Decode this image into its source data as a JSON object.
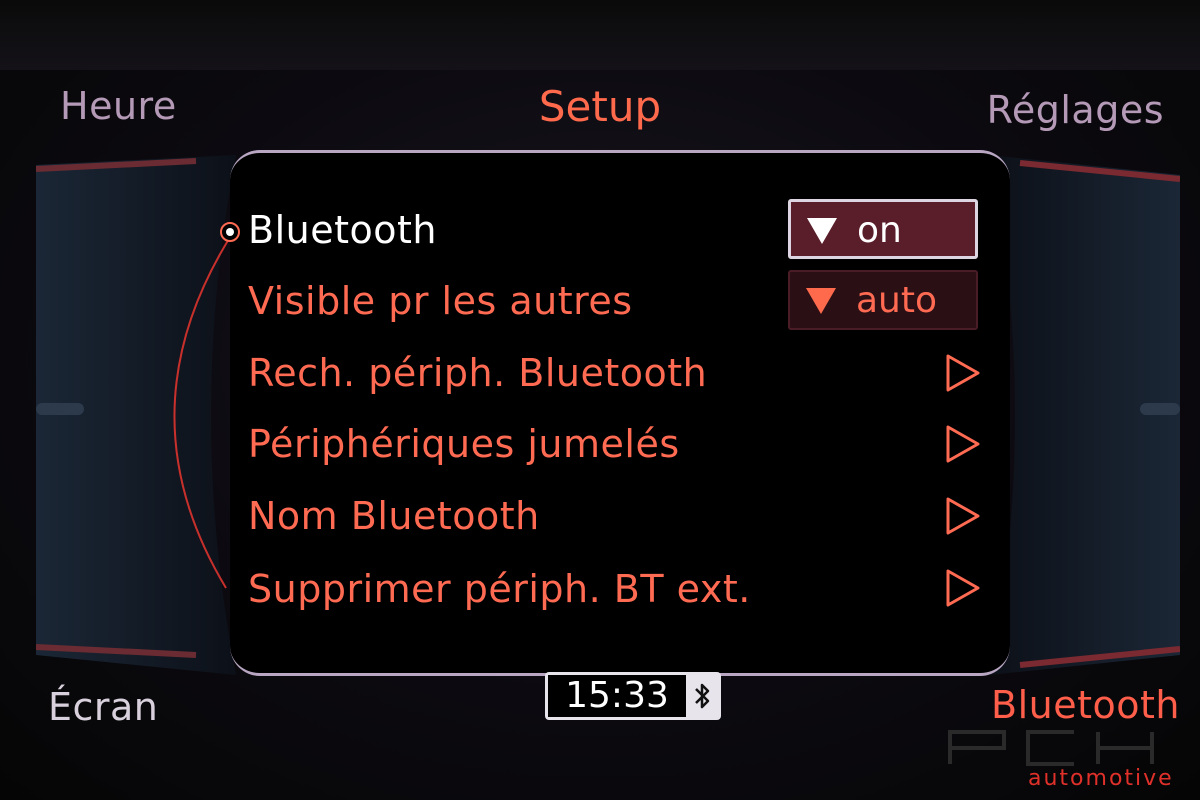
{
  "header": {
    "title": "Setup",
    "softkey_top_left": "Heure",
    "softkey_top_right": "Réglages"
  },
  "footer": {
    "softkey_bottom_left": "Écran",
    "softkey_bottom_right": "Bluetooth",
    "clock": "15:33"
  },
  "menu": {
    "items": [
      {
        "label": "Bluetooth",
        "control": "dropdown",
        "value": "on",
        "selected": true
      },
      {
        "label": "Visible pr les autres",
        "control": "dropdown",
        "value": "auto",
        "selected": false
      },
      {
        "label": "Rech. périph. Bluetooth",
        "control": "submenu"
      },
      {
        "label": "Périphériques jumelés",
        "control": "submenu"
      },
      {
        "label": "Nom Bluetooth",
        "control": "submenu"
      },
      {
        "label": "Supprimer périph. BT ext.",
        "control": "submenu"
      }
    ]
  },
  "icons": {
    "status": "bluetooth-icon",
    "submenu": "play-triangle-icon",
    "dropdown": "down-triangle-icon"
  },
  "colors": {
    "accent": "#ff6a52",
    "selected_text": "#ffffff",
    "dropdown_selected_bg": "#5a1e2a",
    "softkey_inactive": "#b59ab8"
  },
  "watermark": {
    "brand": "PCH",
    "tagline": "automotive"
  }
}
